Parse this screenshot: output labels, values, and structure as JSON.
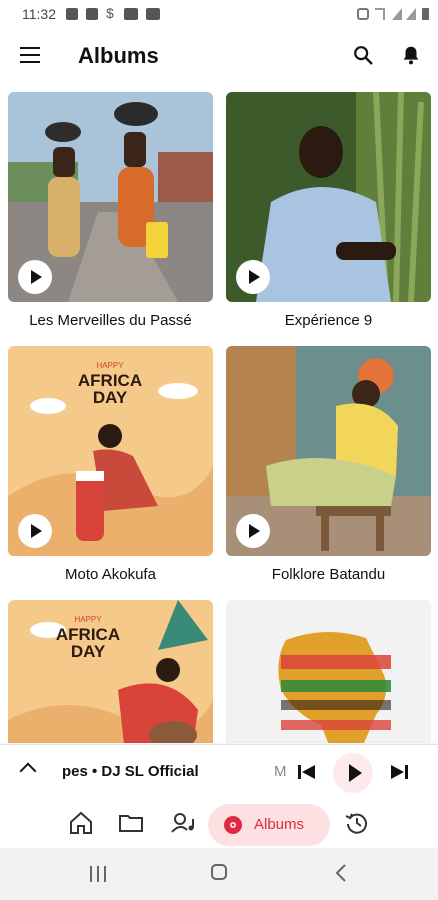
{
  "status_bar": {
    "time": "11:32"
  },
  "header": {
    "title": "Albums"
  },
  "albums": [
    {
      "label": "Les Merveilles du Passé"
    },
    {
      "label": "Expérience 9"
    },
    {
      "label": "Moto Akokufa"
    },
    {
      "label": "Folklore Batandu"
    },
    {
      "label": ""
    },
    {
      "label": ""
    }
  ],
  "artwork_text": {
    "africa_day_happy": "HAPPY",
    "africa_day_line1": "AFRICA",
    "africa_day_line2": "DAY"
  },
  "player": {
    "track": "pes • DJ SL Official",
    "next_prefix": "M"
  },
  "bottom_nav": {
    "active_label": "Albums"
  },
  "colors": {
    "accent": "#e02a43",
    "accent_bg": "#fde0e2"
  }
}
